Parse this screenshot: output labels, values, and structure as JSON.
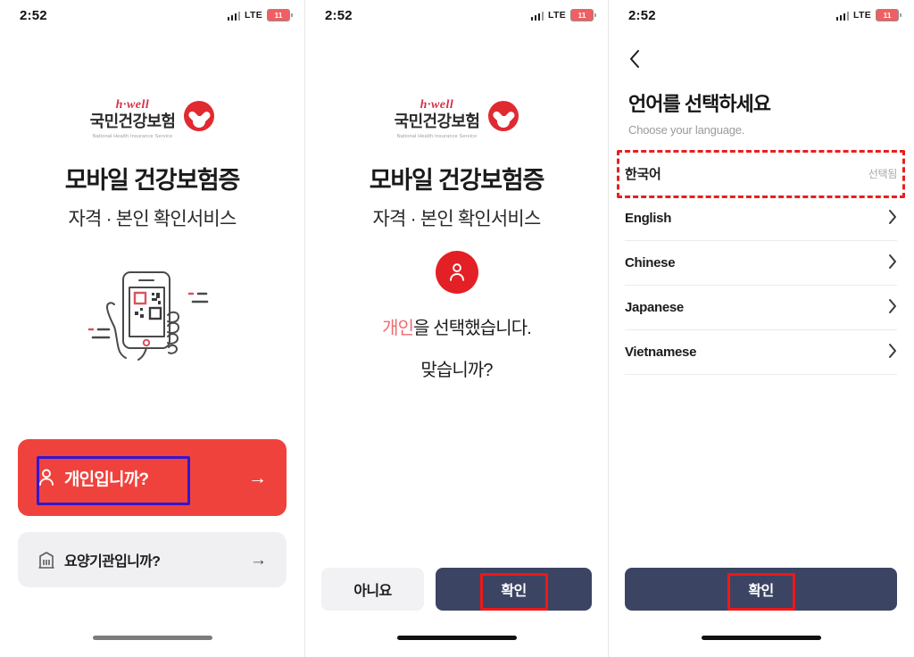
{
  "status_bar": {
    "time": "2:52",
    "network": "LTE",
    "battery_level": "11",
    "signal_icon": "signal-bars-icon",
    "battery_icon": "battery-icon"
  },
  "colors": {
    "primary_red": "#f0423c",
    "brand_red": "#e02a30",
    "navy": "#3b4463",
    "highlight_blue": "#3217cf",
    "highlight_red": "#f01717",
    "light_gray": "#f0f0f2"
  },
  "screen1": {
    "logo": {
      "hwell": "h·well",
      "korean_name": "국민건강보험",
      "english_name": "National Health Insurance Service",
      "mark_icon": "heart-ring-logo-icon"
    },
    "title": "모바일 건강보험증",
    "subtitle": "자격 · 본인 확인서비스",
    "illustration_name": "hand-holding-phone-qr-illustration",
    "primary_button": {
      "label": "개인입니까?",
      "icon": "person-icon",
      "arrow": "→"
    },
    "secondary_button": {
      "label": "요양기관입니까?",
      "icon": "hospital-building-icon",
      "arrow": "→"
    }
  },
  "screen2": {
    "logo": {
      "hwell": "h·well",
      "korean_name": "국민건강보험",
      "english_name": "National Health Insurance Service",
      "mark_icon": "heart-ring-logo-icon"
    },
    "title": "모바일 건강보험증",
    "subtitle": "자격 · 본인 확인서비스",
    "avatar_icon": "person-circle-icon",
    "confirm_highlight": "개인",
    "confirm_rest": "을 선택했습니다.",
    "confirm_question": "맞습니까?",
    "cancel_button": "아니요",
    "confirm_button": "확인"
  },
  "screen3": {
    "back_icon": "chevron-left-icon",
    "title": "언어를 선택하세요",
    "subtitle": "Choose your language.",
    "languages": [
      {
        "name": "한국어",
        "status": "선택됨",
        "selected": true
      },
      {
        "name": "English",
        "chevron": "›",
        "selected": false
      },
      {
        "name": "Chinese",
        "chevron": "›",
        "selected": false
      },
      {
        "name": "Japanese",
        "chevron": "›",
        "selected": false
      },
      {
        "name": "Vietnamese",
        "chevron": "›",
        "selected": false
      }
    ],
    "confirm_button": "확인"
  }
}
